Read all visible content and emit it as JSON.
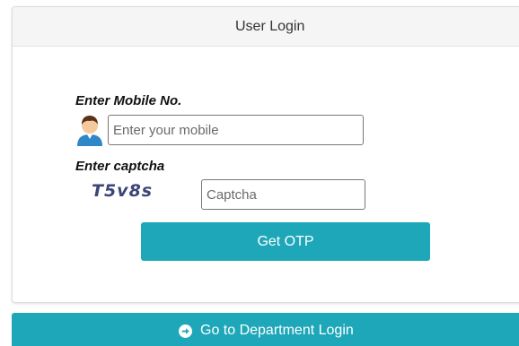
{
  "header": {
    "title": "User Login"
  },
  "mobile": {
    "label": "Enter Mobile No.",
    "placeholder": "Enter your mobile",
    "value": ""
  },
  "captcha": {
    "label": "Enter captcha",
    "code": "T5v8s",
    "placeholder": "Captcha",
    "value": ""
  },
  "buttons": {
    "get_otp": "Get OTP",
    "department_login": "Go to Department Login"
  },
  "icons": {
    "user": "user-avatar-icon",
    "arrow": "arrow-circle-right-icon"
  },
  "colors": {
    "accent": "#1ea7b8",
    "captcha_text": "#3b4677"
  }
}
